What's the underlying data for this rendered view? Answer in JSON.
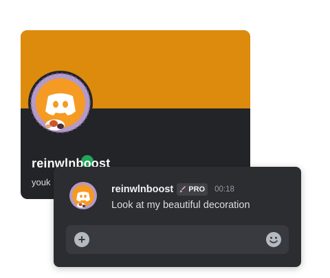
{
  "profile": {
    "username": "reinwlnboost",
    "subtext": "youk",
    "status": "online",
    "banner_color": "#dc8b0c",
    "avatar_icon": "discord-logo-with-cat-decoration"
  },
  "message": {
    "username": "reinwlnboost",
    "badge": "PRO",
    "timestamp": "00:18",
    "text": "Look at my beautiful decoration",
    "avatar_icon": "discord-logo-with-cat-decoration"
  },
  "composer": {
    "add_icon": "plus-circle-icon",
    "emoji_icon": "smiley-icon"
  },
  "colors": {
    "card_bg": "#232428",
    "chat_bg": "#2b2d31",
    "input_bg": "#383a40",
    "status_online": "#23a55a",
    "avatar_orange": "#f59a23",
    "decoration_ring": "#b39ac9"
  }
}
